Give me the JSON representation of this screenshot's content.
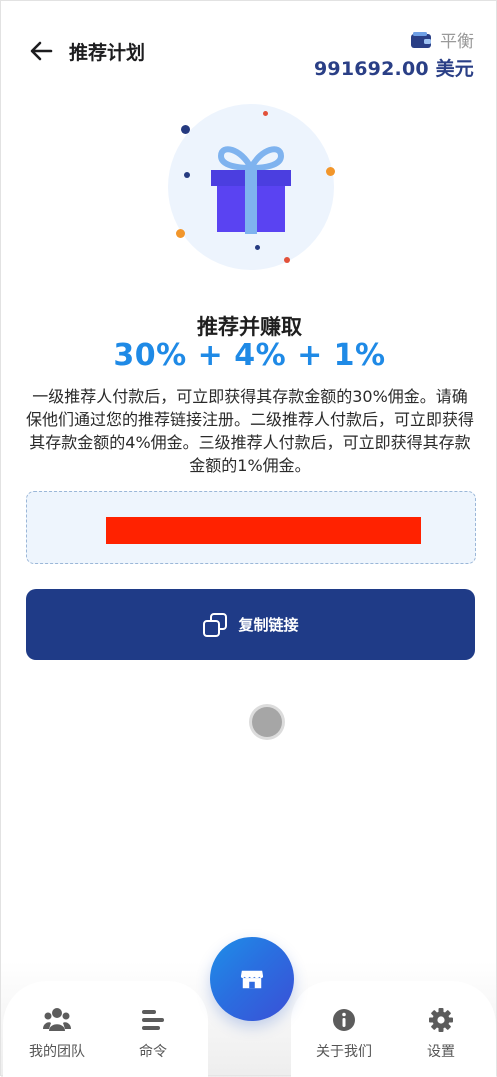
{
  "header": {
    "title": "推荐计划",
    "balance_label": "平衡",
    "balance_value": "991692.00 美元"
  },
  "hero": {
    "headline": "推荐并赚取",
    "percentages": "30% + 4% + 1%",
    "description": "一级推荐人付款后，可立即获得其存款金额的30%佣金。请确保他们通过您的推荐链接注册。二级推荐人付款后，可立即获得其存款金额的4%佣金。三级推荐人付款后，可立即获得其存款金额的1%佣金。"
  },
  "referral": {
    "copy_button_label": "复制链接"
  },
  "bottom_nav": {
    "items": [
      {
        "label": "我的团队",
        "icon": "team-icon"
      },
      {
        "label": "命令",
        "icon": "orders-icon"
      },
      {
        "label": "关于我们",
        "icon": "info-icon"
      },
      {
        "label": "设置",
        "icon": "gear-icon"
      }
    ],
    "center_icon": "store-icon"
  },
  "colors": {
    "accent": "#1f3b87",
    "percent": "#1f8ae6",
    "redaction": "#ff2200"
  }
}
